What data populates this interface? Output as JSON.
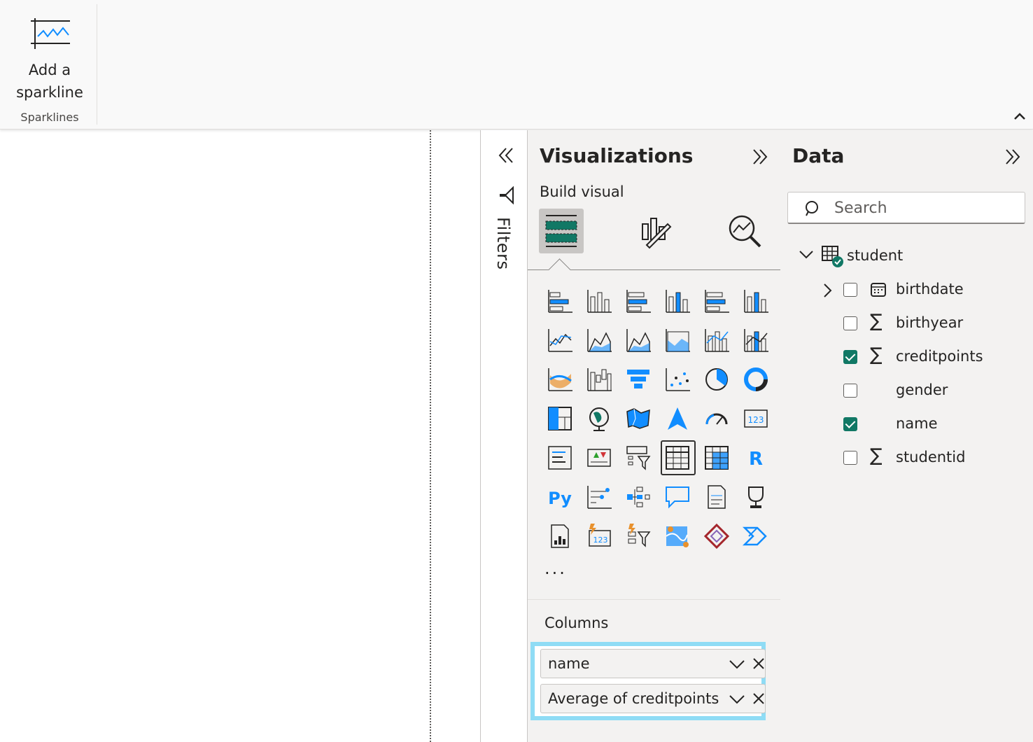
{
  "ribbon": {
    "sparkline_button_label": "Add a sparkline",
    "sparklines_group_label": "Sparklines"
  },
  "filters": {
    "label": "Filters"
  },
  "visualizations": {
    "title": "Visualizations",
    "build_visual_label": "Build visual",
    "tabs": [
      {
        "icon": "build-visual-icon",
        "selected": true
      },
      {
        "icon": "format-visual-icon",
        "selected": false
      },
      {
        "icon": "analytics-icon",
        "selected": false
      }
    ],
    "gallery": [
      "stacked-bar-chart-icon",
      "stacked-column-chart-icon",
      "clustered-bar-chart-icon",
      "clustered-column-chart-icon",
      "100-stacked-bar-chart-icon",
      "100-stacked-column-chart-icon",
      "line-chart-icon",
      "area-chart-icon",
      "stacked-area-chart-icon",
      "100-stacked-area-chart-icon",
      "line-and-stacked-column-chart-icon",
      "line-and-clustered-column-chart-icon",
      "ribbon-chart-icon",
      "waterfall-chart-icon",
      "funnel-chart-icon",
      "scatter-chart-icon",
      "pie-chart-icon",
      "donut-chart-icon",
      "treemap-icon",
      "map-icon",
      "filled-map-icon",
      "azure-map-icon",
      "gauge-icon",
      "card-icon",
      "multi-row-card-icon",
      "kpi-icon",
      "slicer-icon",
      "table-icon",
      "matrix-icon",
      "r-script-visual-icon",
      "python-visual-icon",
      "key-influencers-icon",
      "decomposition-tree-icon",
      "qa-icon",
      "smart-narrative-icon",
      "goals-icon",
      "paginated-report-icon",
      "power-automate-card-icon",
      "power-automate-slicer-icon",
      "arcgis-map-icon",
      "power-apps-icon",
      "power-automate-icon"
    ],
    "active_visual": "table-icon",
    "more_label": "...",
    "columns_label": "Columns",
    "columns": [
      "name",
      "Average of creditpoints"
    ]
  },
  "data": {
    "title": "Data",
    "search_placeholder": "Search",
    "table_name": "student",
    "fields": [
      {
        "name": "birthdate",
        "type": "date-hierarchy-icon",
        "checked": false,
        "expandable": true
      },
      {
        "name": "birthyear",
        "type": "sigma-icon",
        "checked": false,
        "expandable": false
      },
      {
        "name": "creditpoints",
        "type": "sigma-icon",
        "checked": true,
        "expandable": false
      },
      {
        "name": "gender",
        "type": "",
        "checked": false,
        "expandable": false
      },
      {
        "name": "name",
        "type": "",
        "checked": true,
        "expandable": false
      },
      {
        "name": "studentid",
        "type": "sigma-icon",
        "checked": false,
        "expandable": false
      }
    ]
  },
  "colors": {
    "accent_teal": "#117865",
    "well_highlight": "#8fdcf5",
    "chart_blue": "#118dff",
    "pane_bg": "#f3f2f1"
  }
}
